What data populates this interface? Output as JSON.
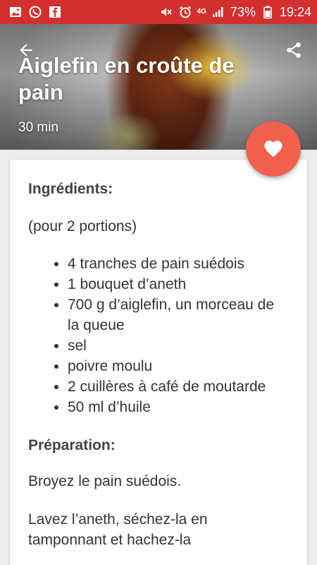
{
  "status_bar": {
    "network": "4G",
    "battery": "73%",
    "time": "19:24",
    "icons": [
      "image-icon",
      "whatsapp-icon",
      "facebook-icon",
      "mute-icon",
      "alarm-icon",
      "signal-icon",
      "battery-icon"
    ]
  },
  "hero": {
    "title": "Aiglefin en croûte de pain",
    "time": "30 min"
  },
  "recipe": {
    "ingredients_heading": "Ingrédients:",
    "portions": "(pour 2 portions)",
    "ingredients": [
      "4 tranches de pain suédois",
      "1 bouquet d’aneth",
      "700 g d’aiglefin, un morceau de la queue",
      "sel",
      "poivre moulu",
      "2 cuillères à café de moutarde",
      "50 ml d’huile"
    ],
    "preparation_heading": "Préparation:",
    "steps": [
      "Broyez le pain suédois.",
      "Lavez l’aneth, séchez-la en tamponnant et hachez-la"
    ]
  },
  "colors": {
    "status_bar": "#d32f2f",
    "fab": "#f0604d"
  }
}
